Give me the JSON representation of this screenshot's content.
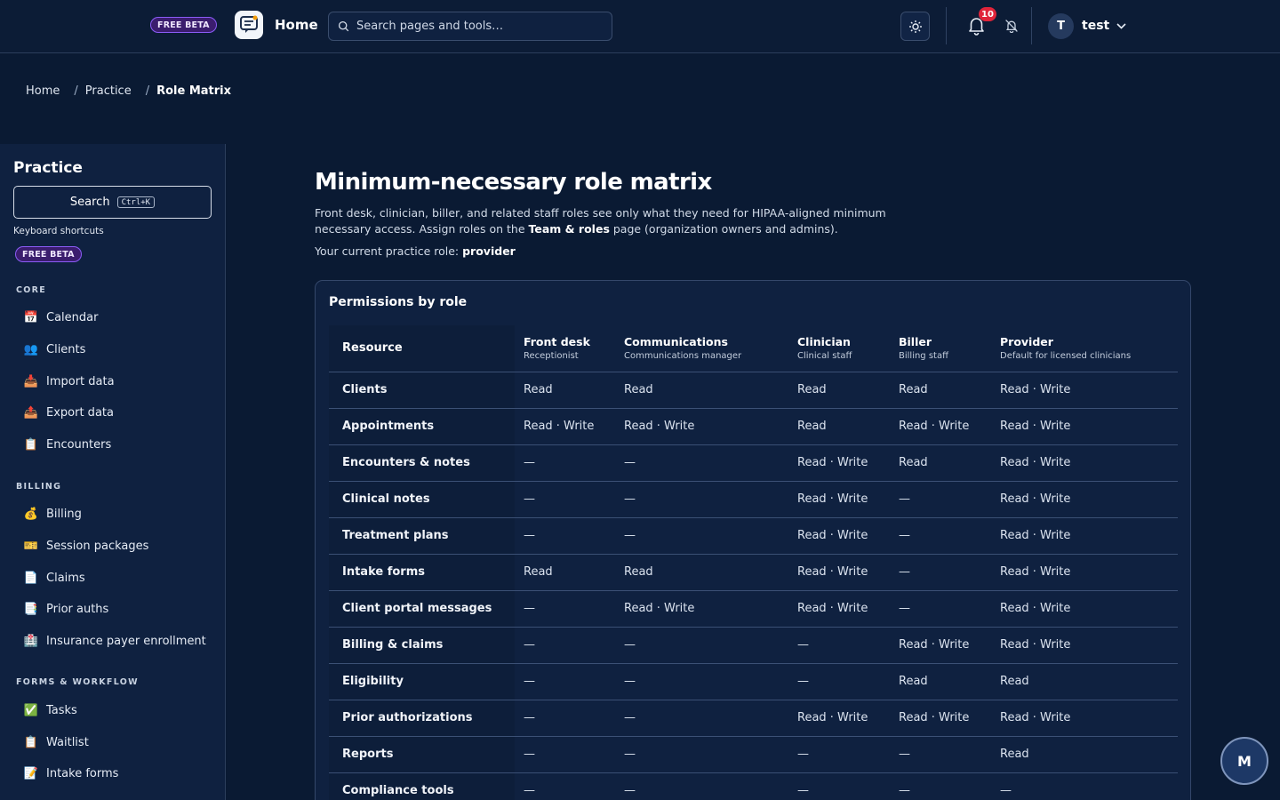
{
  "topbar": {
    "beta_label": "FREE BETA",
    "home_label": "Home",
    "search_placeholder": "Search pages and tools…",
    "notification_count": "10",
    "user_initial": "T",
    "user_name": "test"
  },
  "breadcrumb": {
    "items": [
      "Home",
      "Practice",
      "Role Matrix"
    ],
    "separator": "/"
  },
  "sidebar": {
    "title": "Practice",
    "search_label": "Search",
    "search_shortcut": "Ctrl+K",
    "shortcuts_label": "Keyboard shortcuts",
    "beta_label": "FREE BETA",
    "sections": [
      {
        "label": "CORE",
        "items": [
          {
            "label": "Calendar",
            "icon": "📅"
          },
          {
            "label": "Clients",
            "icon": "👥"
          },
          {
            "label": "Import data",
            "icon": "📥"
          },
          {
            "label": "Export data",
            "icon": "📤"
          },
          {
            "label": "Encounters",
            "icon": "📋"
          }
        ]
      },
      {
        "label": "BILLING",
        "items": [
          {
            "label": "Billing",
            "icon": "💰"
          },
          {
            "label": "Session packages",
            "icon": "🎫"
          },
          {
            "label": "Claims",
            "icon": "📄"
          },
          {
            "label": "Prior auths",
            "icon": "📑"
          },
          {
            "label": "Insurance payer enrollment",
            "icon": "🏥"
          }
        ]
      },
      {
        "label": "FORMS & WORKFLOW",
        "items": [
          {
            "label": "Tasks",
            "icon": "✅"
          },
          {
            "label": "Waitlist",
            "icon": "📋"
          },
          {
            "label": "Intake forms",
            "icon": "📝"
          }
        ]
      }
    ]
  },
  "main": {
    "title": "Minimum-necessary role matrix",
    "desc_part1": "Front desk, clinician, biller, and related staff roles see only what they need for HIPAA-aligned minimum necessary access. Assign roles on the ",
    "desc_link": "Team & roles",
    "desc_part2": " page (organization owners and admins).",
    "role_prefix": "Your current practice role: ",
    "role_value": "provider"
  },
  "matrix": {
    "card_title": "Permissions by role",
    "resource_header": "Resource",
    "columns": [
      {
        "name": "Front desk",
        "sub": "Receptionist"
      },
      {
        "name": "Communications",
        "sub": "Communications manager"
      },
      {
        "name": "Clinician",
        "sub": "Clinical staff"
      },
      {
        "name": "Biller",
        "sub": "Billing staff"
      },
      {
        "name": "Provider",
        "sub": "Default for licensed clinicians"
      }
    ],
    "rows": [
      {
        "resource": "Clients",
        "cells": [
          "Read",
          "Read",
          "Read",
          "Read",
          "Read · Write"
        ]
      },
      {
        "resource": "Appointments",
        "cells": [
          "Read · Write",
          "Read · Write",
          "Read",
          "Read · Write",
          "Read · Write"
        ]
      },
      {
        "resource": "Encounters & notes",
        "cells": [
          "—",
          "—",
          "Read · Write",
          "Read",
          "Read · Write"
        ]
      },
      {
        "resource": "Clinical notes",
        "cells": [
          "—",
          "—",
          "Read · Write",
          "—",
          "Read · Write"
        ]
      },
      {
        "resource": "Treatment plans",
        "cells": [
          "—",
          "—",
          "Read · Write",
          "—",
          "Read · Write"
        ]
      },
      {
        "resource": "Intake forms",
        "cells": [
          "Read",
          "Read",
          "Read · Write",
          "—",
          "Read · Write"
        ]
      },
      {
        "resource": "Client portal messages",
        "cells": [
          "—",
          "Read · Write",
          "Read · Write",
          "—",
          "Read · Write"
        ]
      },
      {
        "resource": "Billing & claims",
        "cells": [
          "—",
          "—",
          "—",
          "Read · Write",
          "Read · Write"
        ]
      },
      {
        "resource": "Eligibility",
        "cells": [
          "—",
          "—",
          "—",
          "Read",
          "Read"
        ]
      },
      {
        "resource": "Prior authorizations",
        "cells": [
          "—",
          "—",
          "Read · Write",
          "Read · Write",
          "Read · Write"
        ]
      },
      {
        "resource": "Reports",
        "cells": [
          "—",
          "—",
          "—",
          "—",
          "Read"
        ]
      },
      {
        "resource": "Compliance tools",
        "cells": [
          "—",
          "—",
          "—",
          "—",
          "—"
        ]
      }
    ]
  },
  "fab": {
    "label": "M"
  }
}
